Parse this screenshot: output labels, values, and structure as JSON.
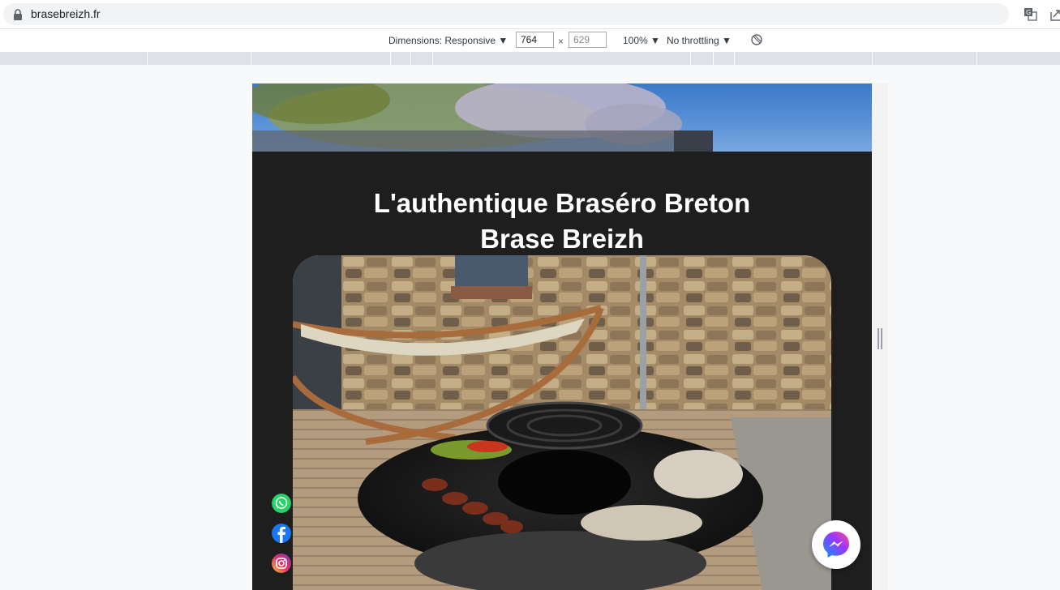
{
  "browser": {
    "url": "brasebreizh.fr",
    "icons": [
      "lock-icon",
      "translate-icon",
      "share-icon"
    ]
  },
  "devtools": {
    "dimensions_label": "Dimensions: Responsive ▼",
    "width_value": "764",
    "height_value": "629",
    "times": "×",
    "zoom_label": "100% ▼",
    "throttle_label": "No throttling ▼",
    "icons": [
      "rotate-icon"
    ]
  },
  "page": {
    "heading_line1": "L'authentique Braséro Breton",
    "heading_line2": "Brase Breizh",
    "social_icons": [
      "whatsapp-icon",
      "facebook-icon",
      "instagram-icon"
    ],
    "chat_icon": "messenger-icon",
    "colors": {
      "background": "#1e1e1e",
      "heading": "#ffffff",
      "whatsapp": "#25d366",
      "facebook": "#1877f2",
      "instagram": "#d6249f"
    }
  }
}
